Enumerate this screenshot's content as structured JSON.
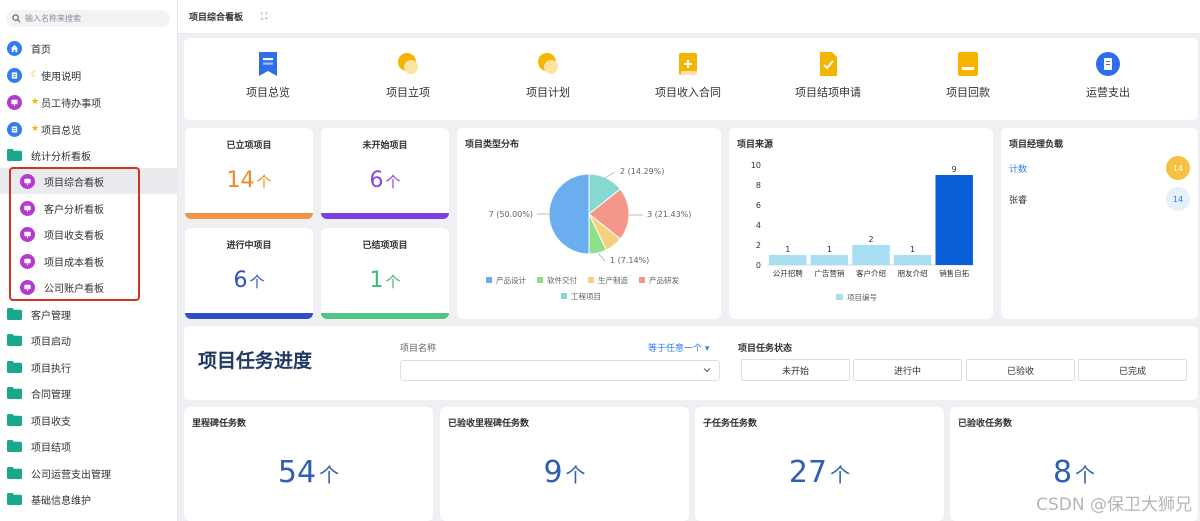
{
  "sidebar": {
    "search_placeholder": "输入名称来搜索",
    "items": [
      {
        "label": "首页"
      },
      {
        "label": "使用说明"
      },
      {
        "label": "员工待办事项"
      },
      {
        "label": "项目总览"
      },
      {
        "label": "统计分析看板"
      },
      {
        "label": "项目综合看板"
      },
      {
        "label": "客户分析看板"
      },
      {
        "label": "项目收支看板"
      },
      {
        "label": "项目成本看板"
      },
      {
        "label": "公司账户看板"
      },
      {
        "label": "客户管理"
      },
      {
        "label": "项目启动"
      },
      {
        "label": "项目执行"
      },
      {
        "label": "合同管理"
      },
      {
        "label": "项目收支"
      },
      {
        "label": "项目结项"
      },
      {
        "label": "公司运营支出管理"
      },
      {
        "label": "基础信息维护"
      }
    ]
  },
  "topbar": {
    "title": "项目综合看板",
    "expand_icon": "expand-icon"
  },
  "quick_links": [
    {
      "label": "项目总览",
      "icon": "bookmark-doc-icon",
      "color": "#2f6ee8"
    },
    {
      "label": "项目立项",
      "icon": "coin-icon",
      "color": "#f5b400"
    },
    {
      "label": "项目计划",
      "icon": "coin-icon",
      "color": "#f5b400"
    },
    {
      "label": "项目收入合同",
      "icon": "contract-icon",
      "color": "#f5b400"
    },
    {
      "label": "项目结项申请",
      "icon": "check-doc-icon",
      "color": "#f5b400"
    },
    {
      "label": "项目回款",
      "icon": "folder-doc-icon",
      "color": "#f5b400"
    },
    {
      "label": "运营支出",
      "icon": "list-circle-icon",
      "color": "#2f6ee8"
    }
  ],
  "stats": {
    "established": {
      "label": "已立项项目",
      "value": "14",
      "unit": "个",
      "color": "#f08a24"
    },
    "not_started": {
      "label": "未开始项目",
      "value": "6",
      "unit": "个",
      "color": "#8a44e0"
    },
    "in_progress": {
      "label": "进行中项目",
      "value": "6",
      "unit": "个",
      "color": "#2f4fc4"
    },
    "completed": {
      "label": "已结项项目",
      "value": "1",
      "unit": "个",
      "color": "#52c484"
    }
  },
  "pie_title": "项目类型分布",
  "bar_title": "项目来源",
  "manager": {
    "title": "项目经理负载",
    "rows": [
      {
        "name": "计数",
        "value": "14"
      },
      {
        "name": "张睿",
        "value": "14"
      }
    ]
  },
  "chart_data": [
    {
      "type": "pie",
      "title": "项目类型分布",
      "slices": [
        {
          "name": "产品设计",
          "value": 7,
          "label": "7 (50.00%)",
          "color": "#6aaef0"
        },
        {
          "name": "软件交付",
          "value": 1,
          "label": "",
          "color": "#8ee08a"
        },
        {
          "name": "生产制造",
          "value": 1,
          "label": "1 (7.14%)",
          "color": "#f7cf7e"
        },
        {
          "name": "产品研发",
          "value": 3,
          "label": "3 (21.43%)",
          "color": "#f4968a"
        },
        {
          "name": "工程项目",
          "value": 2,
          "label": "2 (14.29%)",
          "color": "#86d8d0"
        }
      ],
      "legend": "bottom"
    },
    {
      "type": "bar",
      "title": "项目来源",
      "categories": [
        "公开招聘",
        "广告营销",
        "客户介绍",
        "朋友介绍",
        "销售自拓"
      ],
      "values": [
        1,
        1,
        2,
        1,
        9
      ],
      "series_name": "项目编号",
      "ylim": [
        0,
        10
      ],
      "yticks": [
        0,
        2,
        4,
        6,
        8,
        10
      ],
      "bar_color": "#a8def2",
      "highlight_color": "#0a5fd6",
      "legend": "bottom"
    }
  ],
  "progress": {
    "title": "项目任务进度",
    "filter_label": "项目名称",
    "filter_op": "等于任意一个",
    "status_label": "项目任务状态",
    "statuses": [
      "未开始",
      "进行中",
      "已验收",
      "已完成"
    ]
  },
  "counters": [
    {
      "label": "里程碑任务数",
      "value": "54",
      "unit": "个"
    },
    {
      "label": "已验收里程碑任务数",
      "value": "9",
      "unit": "个"
    },
    {
      "label": "子任务任务数",
      "value": "27",
      "unit": "个"
    },
    {
      "label": "已验收任务数",
      "value": "8",
      "unit": "个"
    }
  ],
  "watermark": "CSDN @保卫大狮兄"
}
